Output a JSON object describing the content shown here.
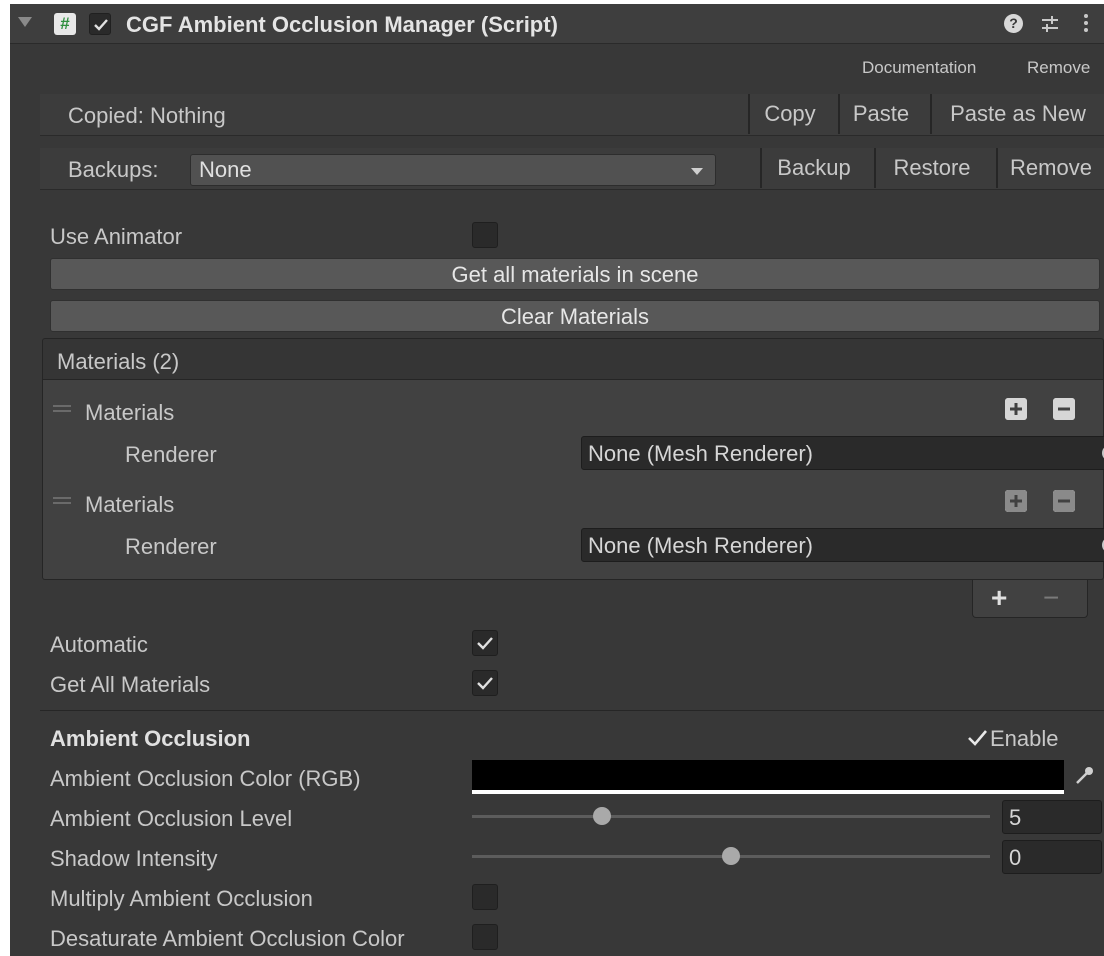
{
  "header": {
    "title": "CGF Ambient Occlusion Manager (Script)",
    "enabled": true,
    "icons": [
      "foldout-arrow-icon",
      "script-icon",
      "checkbox-icon",
      "help-icon",
      "preset-icon",
      "kebab-menu-icon"
    ]
  },
  "links": {
    "documentation": "Documentation",
    "remove": "Remove"
  },
  "copy_bar": {
    "status": "Copied: Nothing",
    "copy": "Copy",
    "paste": "Paste",
    "paste_as_new": "Paste as New"
  },
  "backup_bar": {
    "label": "Backups:",
    "selected": "None",
    "backup": "Backup",
    "restore": "Restore",
    "remove": "Remove"
  },
  "fields": {
    "use_animator": {
      "label": "Use Animator",
      "checked": false
    },
    "get_all_materials_button": "Get all materials in scene",
    "clear_materials_button": "Clear Materials"
  },
  "materials_list": {
    "header": "Materials (2)",
    "items": [
      {
        "label": "Materials",
        "renderer_label": "Renderer",
        "renderer_value": "None (Mesh Renderer)"
      },
      {
        "label": "Materials",
        "renderer_label": "Renderer",
        "renderer_value": "None (Mesh Renderer)"
      }
    ],
    "add": "+",
    "remove": "−"
  },
  "options": {
    "automatic": {
      "label": "Automatic",
      "checked": true
    },
    "get_all_materials": {
      "label": "Get All Materials",
      "checked": true
    }
  },
  "ambient_occlusion": {
    "section_title": "Ambient Occlusion",
    "enable_label": "Enable",
    "enable_checked": true,
    "color": {
      "label": "Ambient Occlusion Color (RGB)",
      "value": "#000000"
    },
    "level": {
      "label": "Ambient Occlusion Level",
      "value": "5",
      "slider_fraction": 0.25
    },
    "shadow_intensity": {
      "label": "Shadow Intensity",
      "value": "0",
      "slider_fraction": 0.5
    },
    "multiply": {
      "label": "Multiply Ambient Occlusion",
      "checked": false
    },
    "desaturate": {
      "label": "Desaturate Ambient Occlusion Color",
      "checked": false
    }
  }
}
